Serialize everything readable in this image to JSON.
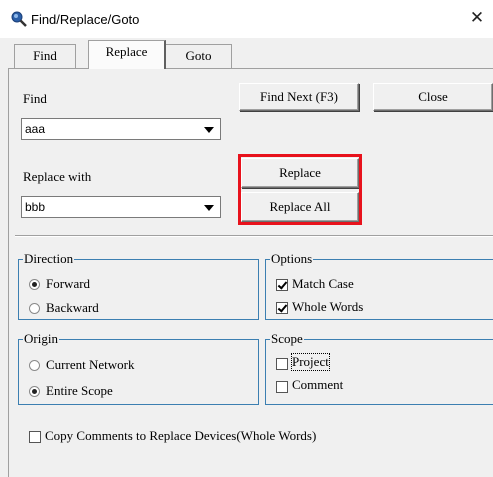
{
  "window": {
    "title": "Find/Replace/Goto",
    "close_glyph": "✕"
  },
  "tabs": [
    {
      "label": "Find",
      "active": false
    },
    {
      "label": "Replace",
      "active": true
    },
    {
      "label": "Goto",
      "active": false
    }
  ],
  "find": {
    "label": "Find",
    "value": "aaa"
  },
  "replace_with": {
    "label": "Replace with",
    "value": "bbb"
  },
  "buttons": {
    "find_next": "Find Next (F3)",
    "close": "Close",
    "replace": "Replace",
    "replace_all": "Replace All"
  },
  "direction": {
    "title": "Direction",
    "options": [
      {
        "label": "Forward",
        "checked": true
      },
      {
        "label": "Backward",
        "checked": false
      }
    ]
  },
  "options": {
    "title": "Options",
    "items": [
      {
        "label": "Match Case",
        "checked": true
      },
      {
        "label": "Whole Words",
        "checked": true
      }
    ]
  },
  "origin": {
    "title": "Origin",
    "options": [
      {
        "label": "Current Network",
        "checked": false
      },
      {
        "label": "Entire Scope",
        "checked": true
      }
    ]
  },
  "scope": {
    "title": "Scope",
    "items": [
      {
        "label": "Project",
        "checked": false
      },
      {
        "label": "Comment",
        "checked": false
      }
    ]
  },
  "copy_comments": {
    "label": "Copy Comments to Replace Devices(Whole Words)",
    "checked": false
  },
  "colors": {
    "highlight": "#e8121c",
    "group_border": "#3c7fb1"
  },
  "icons": {
    "title": "magnifier-icon"
  }
}
